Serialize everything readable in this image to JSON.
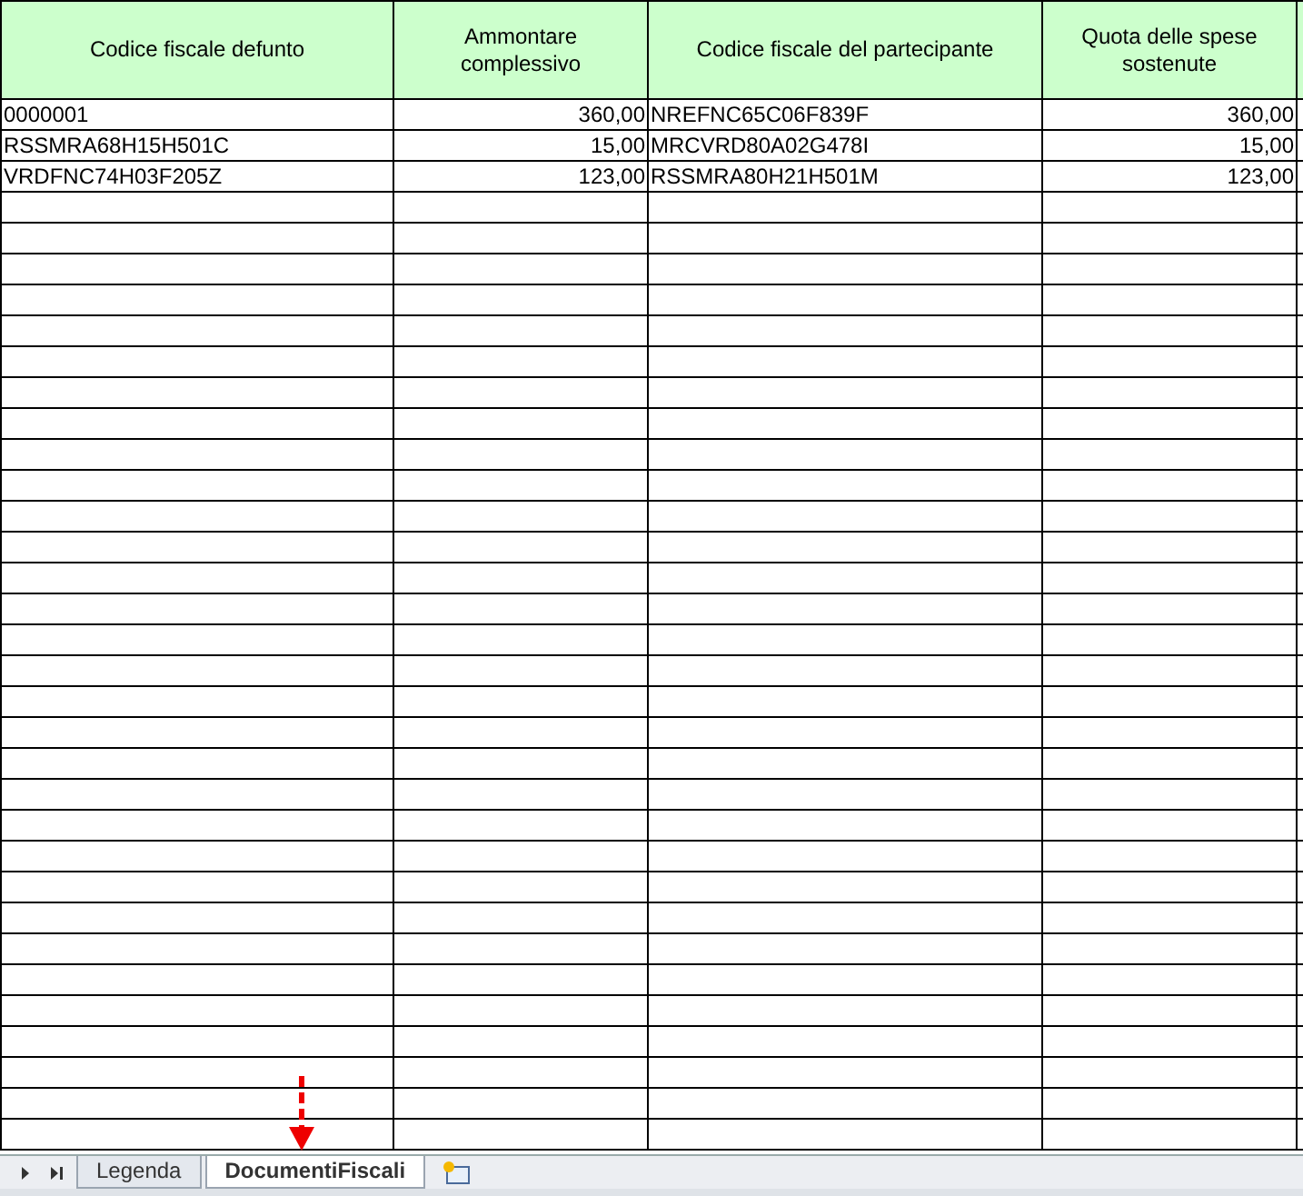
{
  "table": {
    "columns": [
      "Codice fiscale defunto",
      "Ammontare complessivo",
      "Codice fiscale del partecipante",
      "Quota delle spese sostenute"
    ],
    "rows": [
      {
        "cells": [
          "0000001",
          "360,00",
          "NREFNC65C06F839F",
          "360,00"
        ]
      },
      {
        "cells": [
          "RSSMRA68H15H501C",
          "15,00",
          "MRCVRD80A02G478I",
          "15,00"
        ]
      },
      {
        "cells": [
          "VRDFNC74H03F205Z",
          "123,00",
          "RSSMRA80H21H501M",
          "123,00"
        ]
      }
    ]
  },
  "sheet_tabs": [
    {
      "label": "Legenda",
      "selected": false
    },
    {
      "label": "DocumentiFiscali",
      "selected": true
    }
  ]
}
